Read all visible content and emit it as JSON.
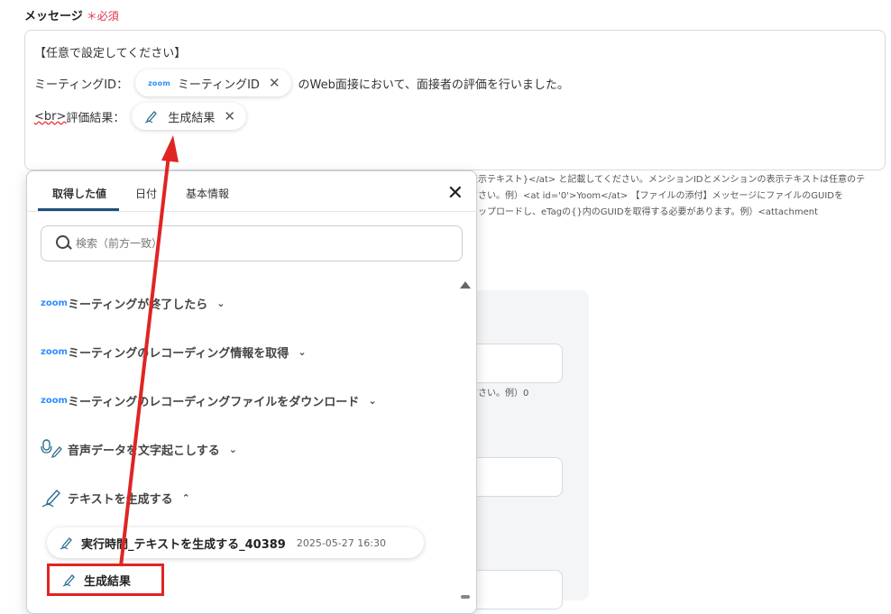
{
  "field": {
    "label": "メッセージ",
    "required_mark": "＊",
    "required_text": "必須"
  },
  "editor": {
    "line1": "【任意で設定してください】",
    "line2_prefix": "ミーティングID：",
    "line2_chip": {
      "logo": "zoom",
      "label": "ミーティングID",
      "close": "✕"
    },
    "line2_suffix": "のWeb面接において、面接者の評価を行いました。",
    "line3_br": "<br>",
    "line3_prefix": "評価結果：",
    "line3_chip": {
      "label": "生成結果",
      "close": "✕"
    }
  },
  "helper": {
    "line1": "表示テキスト}</at> と記載してください。メンションIDとメンションの表示テキストは任意のテ",
    "line2": "ださい。例）<at id='0'>Yoom</at> 【ファイルの添付】メッセージにファイルのGUIDを",
    "line3": "アップロードし、eTagの{}内のGUIDを取得する必要があります。例）<attachment",
    "line4": "ださい。例）0"
  },
  "panel": {
    "tabs": [
      "取得した値",
      "日付",
      "基本情報"
    ],
    "close": "✕",
    "search_placeholder": "検索（前方一致）",
    "items": [
      {
        "icon": "zoom",
        "label": "ミーティングが終了したら",
        "chevron": "⌄"
      },
      {
        "icon": "zoom",
        "label": "ミーティングのレコーディング情報を取得",
        "chevron": "⌄"
      },
      {
        "icon": "zoom",
        "label": "ミーティングのレコーディングファイルをダウンロード",
        "chevron": "⌄"
      },
      {
        "icon": "voice-pen-icon",
        "label": "音声データを文字起こしする",
        "chevron": "⌄"
      },
      {
        "icon": "pen-icon",
        "label": "テキストを生成する",
        "chevron": "⌃"
      }
    ],
    "result_row": {
      "label": "実行時間_テキストを生成する_40389",
      "timestamp": "2025-05-27 16:30"
    },
    "generated_result": "生成結果"
  },
  "colors": {
    "accent": "#1f4f7a",
    "required": "#e0334a",
    "highlight": "#e02424",
    "zoom": "#2d8cff"
  }
}
